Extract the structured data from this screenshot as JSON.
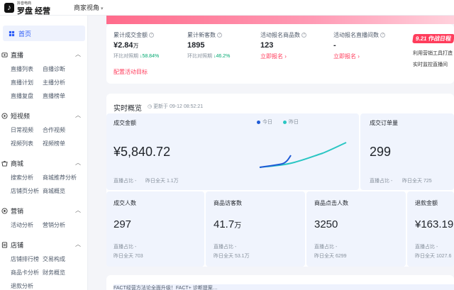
{
  "header": {
    "logo_sub": "抖音电商",
    "logo_main": "罗盘 经营",
    "role": "商家视角"
  },
  "sidebar": {
    "home": "首页",
    "groups": [
      {
        "title": "直播",
        "items": [
          "直播列表",
          "自播诊断",
          "直播计划",
          "主播分析",
          "直播复盘",
          "直播榜单"
        ]
      },
      {
        "title": "短视频",
        "items": [
          "日常视频",
          "合作视频",
          "视频列表",
          "视频榜单"
        ]
      },
      {
        "title": "商城",
        "items": [
          "搜索分析",
          "商城推荐分析",
          "店铺页分析",
          "商城概览"
        ]
      },
      {
        "title": "营销",
        "items": [
          "活动分析",
          "营销分析"
        ]
      },
      {
        "title": "店铺",
        "items": [
          "店铺排行榜",
          "交易构成",
          "商品卡分析",
          "财务概览",
          "退款分析"
        ]
      }
    ]
  },
  "top_stats": [
    {
      "label": "累计成交金额",
      "value": "¥2.84",
      "unit": "万",
      "cmp_label": "环比对照期",
      "cmp_value": "↓58.84%"
    },
    {
      "label": "累计新客数",
      "value": "1895",
      "unit": "",
      "cmp_label": "环比对照期",
      "cmp_value": "↓46.2%"
    },
    {
      "label": "活动报名商品数",
      "value": "123",
      "unit": "",
      "link": "立即报名 ›"
    },
    {
      "label": "活动报名直播间数",
      "value": "-",
      "unit": "",
      "link": "立即报名 ›"
    }
  ],
  "goal_link": "配置活动目标",
  "promo": {
    "tag": "9.21 作战日程",
    "line1": "利用营销工具打造",
    "line2": "实时监控直播间"
  },
  "realtime": {
    "title": "实时概览",
    "updated": "更新于 09-12 08:52:21",
    "legend_today": "今日",
    "legend_yesterday": "昨日",
    "gmv": {
      "label": "成交金额",
      "value": "¥5,840.72",
      "sub_a": "直播占比 -",
      "sub_b": "昨日全天 1.1万"
    },
    "orders": {
      "label": "成交订单量",
      "value": "299",
      "sub_a": "直播占比 -",
      "sub_b": "昨日全天 725"
    },
    "buyers": {
      "label": "成交人数",
      "value": "297",
      "sub_a": "直播占比 -",
      "sub_b": "昨日全天 703"
    },
    "visitors": {
      "label": "商品访客数",
      "value": "41.7",
      "unit": "万",
      "sub_a": "直播占比 -",
      "sub_b": "昨日全天 53.1万"
    },
    "exposure": {
      "label": "商品点击人数",
      "value": "3250",
      "sub_a": "直播占比 -",
      "sub_b": "昨日全天 6299"
    },
    "refund": {
      "label": "退款金额",
      "value": "¥163.19",
      "sub_a": "直播占比 -",
      "sub_b": "昨日全天 1027.6"
    }
  },
  "colors": {
    "accent": "#2d5cf6",
    "today": "#1f5bd6",
    "yesterday": "#2ac6c3",
    "brand": "#ff3d5c"
  },
  "notice": "FACT经营方法论全面升级！FACT+ 诊断提案…"
}
